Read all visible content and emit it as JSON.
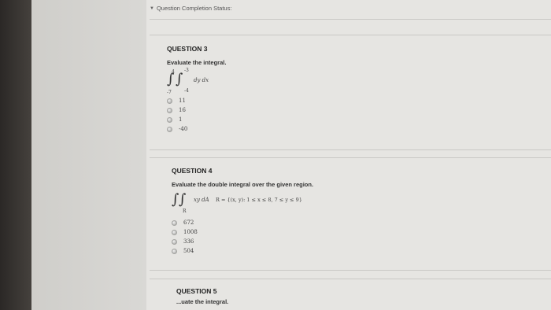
{
  "status": {
    "label": "Question Completion Status:"
  },
  "q3": {
    "title": "QUESTION 3",
    "prompt": "Evaluate the integral.",
    "outer_lower": "-7",
    "outer_upper": "4",
    "inner_lower": "-4",
    "inner_upper": "-3",
    "integrand": "dy dx",
    "options": [
      "11",
      "16",
      "1",
      "-40"
    ]
  },
  "q4": {
    "title": "QUESTION 4",
    "prompt": "Evaluate the double integral over the given region.",
    "region_label": "R",
    "integrand": "xy dA",
    "region": "R = {(x, y): 1 ≤ x ≤ 8, 7 ≤ y ≤ 9}",
    "options": [
      "672",
      "1008",
      "336",
      "504"
    ]
  },
  "q5": {
    "title": "QUESTION 5",
    "prompt_partial": "...uate the integral."
  }
}
